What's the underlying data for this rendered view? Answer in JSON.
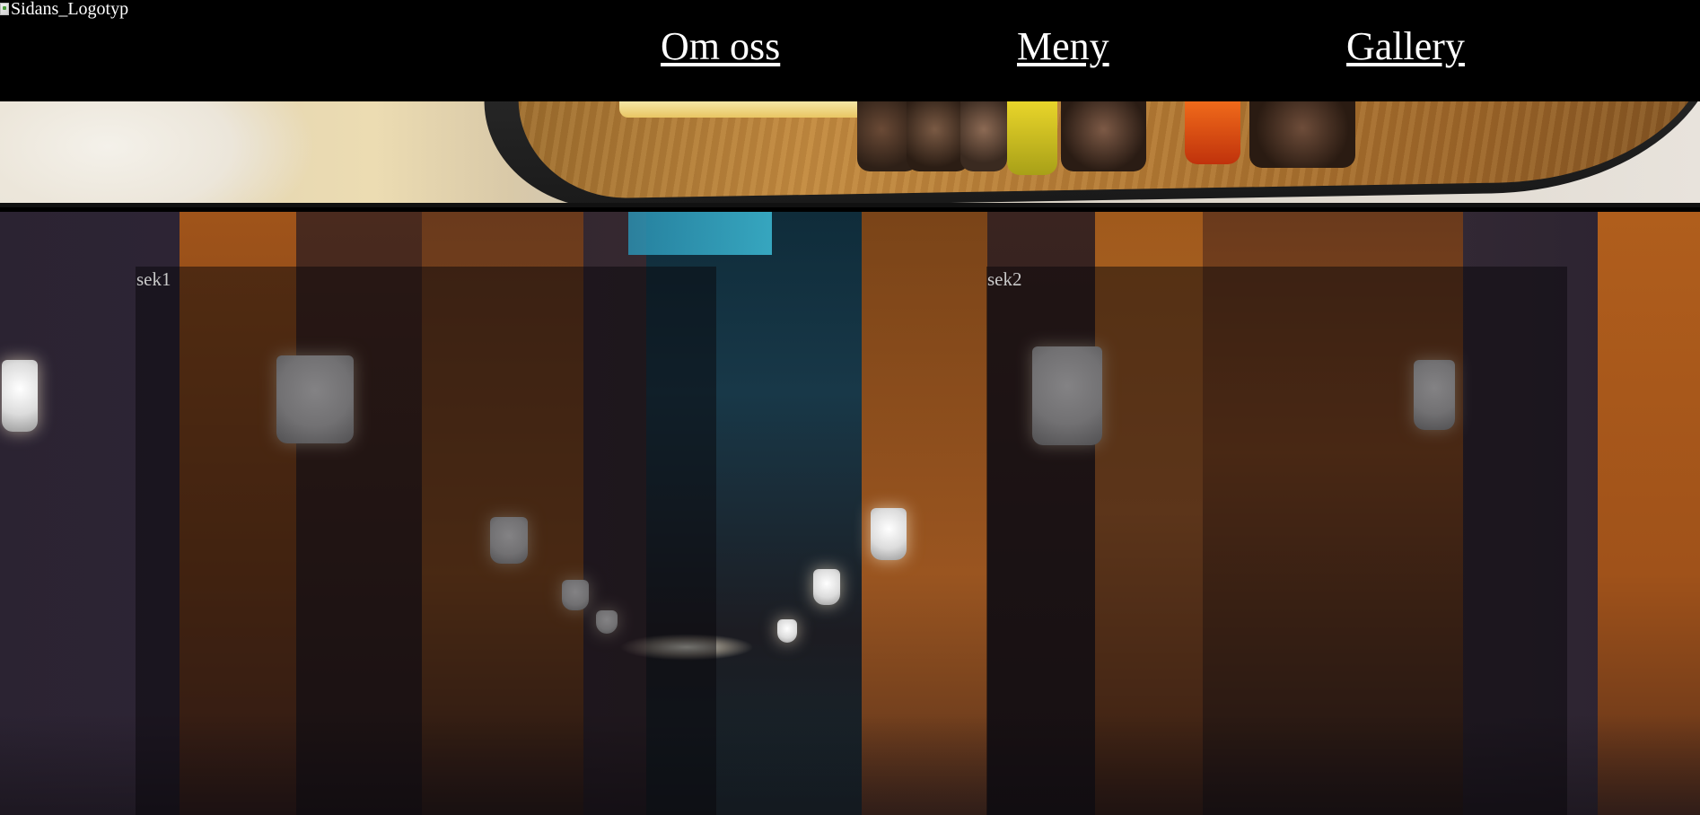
{
  "header": {
    "logo_alt": "Sidans_Logotyp"
  },
  "nav": {
    "items": [
      {
        "label": "Om oss"
      },
      {
        "label": "Meny"
      },
      {
        "label": "Gallery"
      }
    ]
  },
  "sections": [
    {
      "label": "sek1"
    },
    {
      "label": "sek2"
    }
  ],
  "colors": {
    "header_bg": "#000000",
    "nav_text": "#ffffff",
    "section_overlay": "rgba(8,6,10,0.5)"
  }
}
